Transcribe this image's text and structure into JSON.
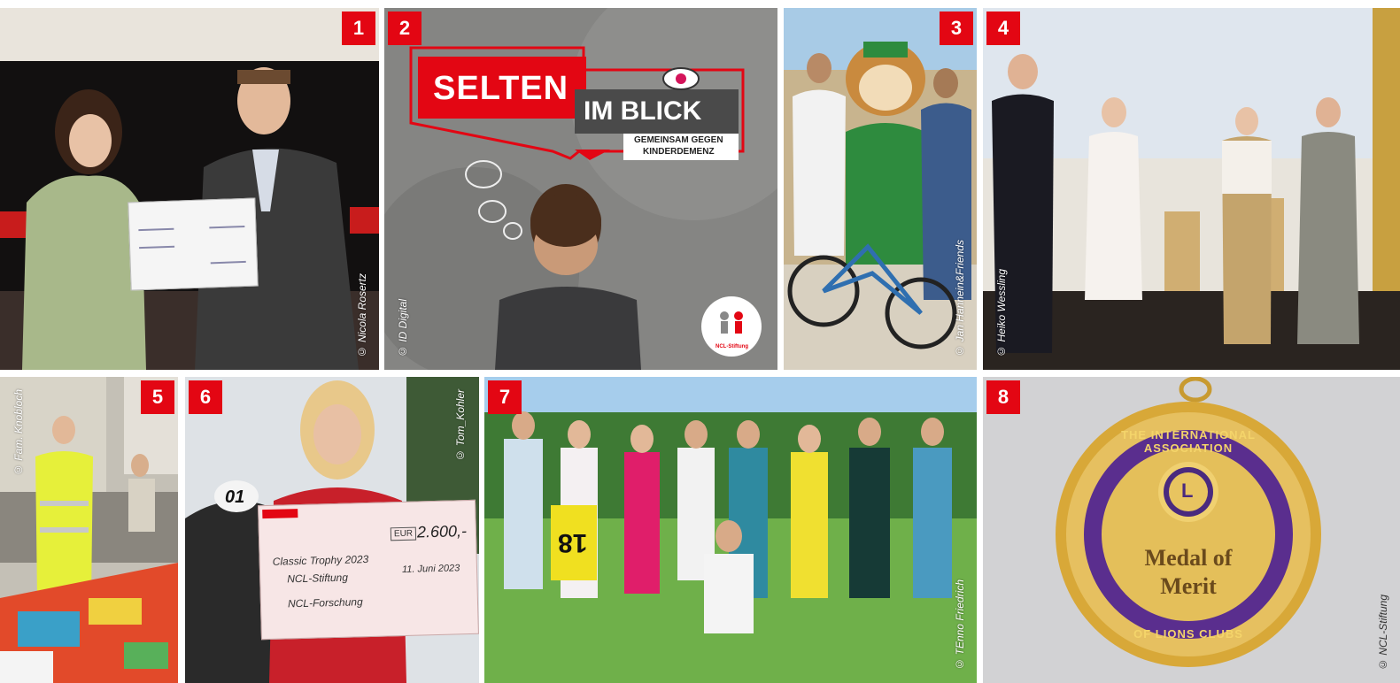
{
  "tiles": [
    {
      "number": "1",
      "credit": "© Nicola Rosertz"
    },
    {
      "number": "2",
      "credit": "© ID Digital",
      "logo_title": "SELTEN",
      "logo_subtitle": "IM BLICK",
      "logo_tagline_1": "GEMEINSAM GEGEN",
      "logo_tagline_2": "KINDERDEMENZ",
      "foundation": "NCL-Stiftung"
    },
    {
      "number": "3",
      "credit": "© Jan Hannein&Friends"
    },
    {
      "number": "4",
      "credit": "© Heiko Wessling"
    },
    {
      "number": "5",
      "credit": "© Fam. Knobloch"
    },
    {
      "number": "6",
      "credit": "© Tom_Kohler",
      "car_number": "01",
      "check_amount": "2.600,-",
      "check_currency": "EUR",
      "check_line_1": "Classic Trophy 2023",
      "check_line_2": "NCL-Stiftung",
      "check_line_3": "NCL-Forschung",
      "check_date": "11. Juni 2023"
    },
    {
      "number": "7",
      "credit": "© TEnno Friedrich",
      "flag_number": "18"
    },
    {
      "number": "8",
      "credit": "© NCL-Stiftung",
      "medal_top": "THE INTERNATIONAL ASSOCIATION",
      "medal_bottom": "OF LIONS CLUBS",
      "medal_line_1": "Medal of",
      "medal_line_2": "Merit",
      "medal_emblem": "L"
    }
  ],
  "colors": {
    "badge": "#e30613",
    "background": "#ffffff"
  }
}
